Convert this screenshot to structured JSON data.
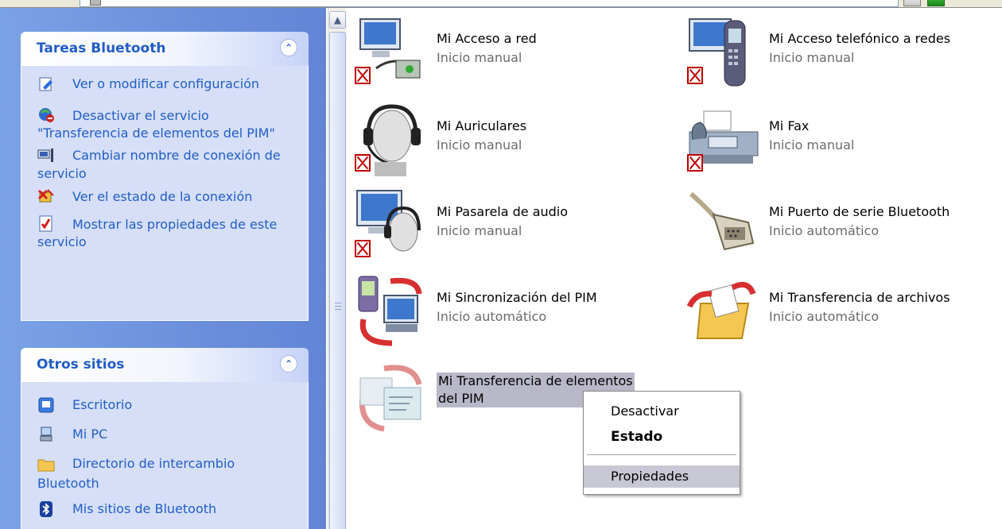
{
  "sidebar": {
    "panels": [
      {
        "title": "Tareas Bluetooth",
        "items": [
          {
            "label": "Ver o modificar configuración",
            "icon": "settings-edit-icon"
          },
          {
            "label": "Desactivar el servicio \"Transferencia de elementos del PIM\"",
            "icon": "disable-service-icon"
          },
          {
            "label": "Cambiar nombre de conexión de servicio",
            "icon": "rename-connection-icon"
          },
          {
            "label": "Ver el estado de la conexión",
            "icon": "connection-status-icon"
          },
          {
            "label": "Mostrar las propiedades de este servicio",
            "icon": "properties-icon"
          }
        ]
      },
      {
        "title": "Otros sitios",
        "items": [
          {
            "label": "Escritorio",
            "icon": "desktop-icon"
          },
          {
            "label": "Mi PC",
            "icon": "my-computer-icon"
          },
          {
            "label": "Directorio de intercambio Bluetooth",
            "icon": "folder-icon"
          },
          {
            "label": "Mis sitios de Bluetooth",
            "icon": "bluetooth-icon"
          }
        ]
      }
    ]
  },
  "services": [
    {
      "name": "Mi Acceso a red",
      "status": "Inicio manual",
      "icon": "network-access-icon"
    },
    {
      "name": "Mi Acceso telefónico a redes",
      "status": "Inicio manual",
      "icon": "dialup-phone-icon"
    },
    {
      "name": "Mi Auriculares",
      "status": "Inicio manual",
      "icon": "headset-icon"
    },
    {
      "name": "Mi Fax",
      "status": "Inicio manual",
      "icon": "fax-icon"
    },
    {
      "name": "Mi Pasarela de audio",
      "status": "Inicio manual",
      "icon": "audio-gateway-icon"
    },
    {
      "name": "Mi Puerto de serie Bluetooth",
      "status": "Inicio automático",
      "icon": "serial-port-icon"
    },
    {
      "name": "Mi Sincronización del PIM",
      "status": "Inicio automático",
      "icon": "pim-sync-icon"
    },
    {
      "name": "Mi Transferencia de archivos",
      "status": "Inicio automático",
      "icon": "file-transfer-icon"
    },
    {
      "name_line1": "Mi Transferencia de elementos",
      "name_line2": "del PIM",
      "icon": "pim-item-transfer-icon"
    }
  ],
  "context_menu": {
    "items": [
      "Desactivar",
      "Estado",
      "Propiedades"
    ],
    "bold_item": "Estado",
    "highlighted_item": "Propiedades"
  },
  "colors": {
    "taskpane_blue": "#6b8fdc",
    "link_blue": "#215dc6",
    "panel_body": "#d6dff7",
    "disabled_red": "#c00000"
  }
}
